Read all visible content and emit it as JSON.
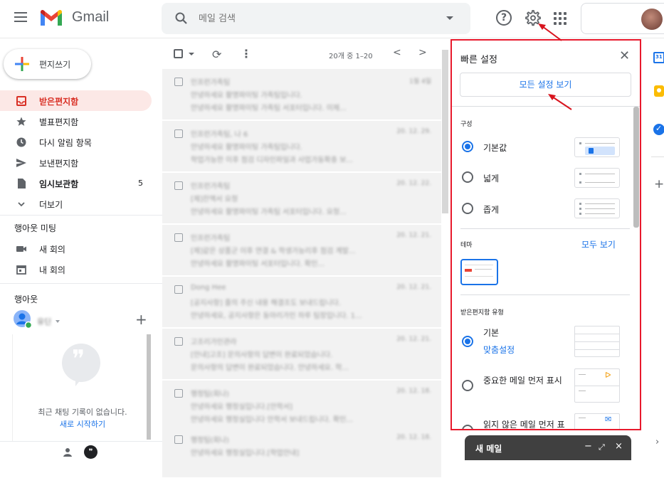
{
  "header": {
    "app_name": "Gmail",
    "search_placeholder": "메일 검색",
    "help_glyph": "?"
  },
  "sidebar": {
    "compose_label": "편지쓰기",
    "items": [
      {
        "label": "받은편지함",
        "count": "",
        "icon": "inbox-icon"
      },
      {
        "label": "별표편지함",
        "count": "",
        "icon": "star-icon"
      },
      {
        "label": "다시 알림 항목",
        "count": "",
        "icon": "clock-icon"
      },
      {
        "label": "보낸편지함",
        "count": "",
        "icon": "send-icon"
      },
      {
        "label": "임시보관함",
        "count": "5",
        "icon": "draft-icon"
      },
      {
        "label": "더보기",
        "count": "",
        "icon": "chevron-down-icon"
      }
    ],
    "meet": {
      "title": "행아웃 미팅",
      "items": [
        {
          "label": "새 회의",
          "icon": "video-icon"
        },
        {
          "label": "내 회의",
          "icon": "calendar-icon"
        }
      ]
    },
    "hangouts": {
      "title": "행아웃",
      "user_name": "유딘",
      "empty_text": "최근 채팅 기록이 없습니다.",
      "start_new": "새로 시작하기"
    }
  },
  "list": {
    "pagination": "20개 중 1–20",
    "emails": [
      {
        "sender": "인프런가족팀",
        "subject": "안녕하세요 활명파이팅 가족팀입니다.",
        "snippet": "안녕하세요 활명파이팅 가족팀 서포터입니다. 이제...",
        "date": "1월 4일"
      },
      {
        "sender": "인프런가족팀, 나 6",
        "subject": "안녕하세요 활명파이팅 가족팀입니다.",
        "snippet": "학업가능한 이후 점검 디자인파일과 사업가동확충 보...",
        "date": "20. 12. 29."
      },
      {
        "sender": "인프런가족팀",
        "subject": "[제]잔액서 요청",
        "snippet": "안녕하세요 활명파이팅 가족팀 서포터입니다. 요청...",
        "date": "20. 12. 22."
      },
      {
        "sender": "인프런가족팀",
        "subject": "[제]같은 상품군 이후 연결 & 학생가능리후 점검 계발...",
        "snippet": "안녕하세요 활명파이팅 서포터입니다. 확인...",
        "date": "20. 12. 21."
      },
      {
        "sender": "Dong Hee",
        "subject": "[공지사항] 줄의 주신 내용 해결조도 보내드립니다.",
        "snippet": "안녕하세요, 공지사항은 동아리가인 하루 팀장입니다. 1...",
        "date": "20. 12. 21."
      },
      {
        "sender": "고조리가인관라",
        "subject": "[안내]고조] 문의사항의 답변이 완료되었습니다.",
        "snippet": "문의사항의 답변이 완료되었습니다. 안녕하세요. 학...",
        "date": "20. 12. 21."
      },
      {
        "sender": "행정팀(회나)",
        "subject": "안녕하세요 행정실입니다.[안학서]",
        "snippet": "안녕하세요 행정실입니다 안학서 보내드립니다. 확인...",
        "date": "20. 12. 18."
      },
      {
        "sender": "행정팀(회나)",
        "subject": "안녕하세요 행정실입니다.[학업안내]",
        "snippet": "",
        "date": "20. 12. 18."
      }
    ]
  },
  "quick_settings": {
    "title": "빠른 설정",
    "see_all": "모든 설정 보기",
    "density_heading": "구성",
    "density_options": [
      {
        "label": "기본값",
        "selected": true
      },
      {
        "label": "넓게",
        "selected": false
      },
      {
        "label": "좁게",
        "selected": false
      }
    ],
    "theme_heading": "테마",
    "theme_view_all": "모두 보기",
    "inbox_type_heading": "받은편지함 유형",
    "inbox_options": [
      {
        "label": "기본",
        "link": "맞춤설정",
        "selected": true
      },
      {
        "label": "중요한 메일 먼저 표시",
        "link": "",
        "selected": false
      },
      {
        "label": "읽지 않은 메일 먼저 표시",
        "link": "",
        "selected": false
      }
    ]
  },
  "compose_bar": {
    "title": "새 메일",
    "minimize": "−",
    "expand": "⤢",
    "close": "×"
  },
  "colors": {
    "accent": "#1a73e8",
    "highlight_box": "#e8192c",
    "inbox_active": "#d93025"
  }
}
